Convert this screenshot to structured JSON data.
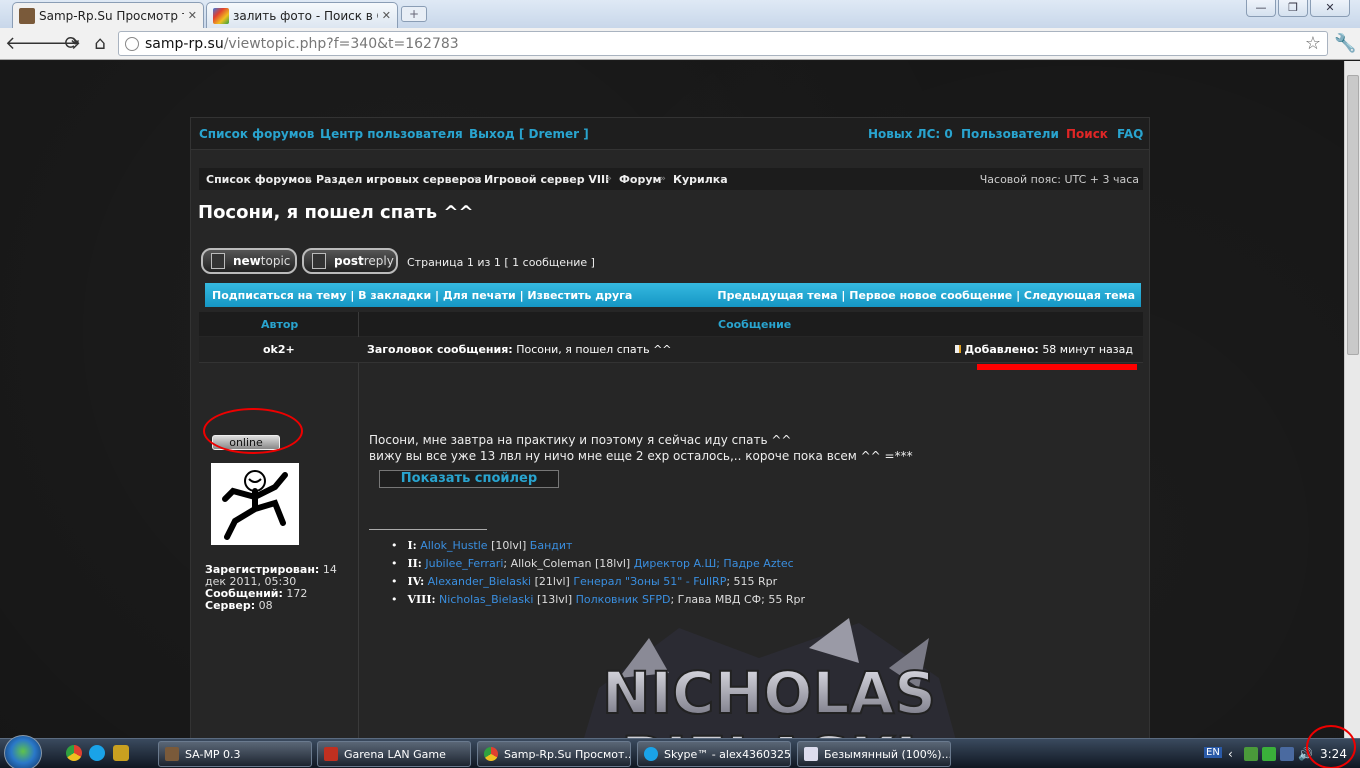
{
  "tabs": [
    {
      "title": "Samp-Rp.Su Просмотр темы -",
      "active": true
    },
    {
      "title": "залить фото - Поиск в Googl",
      "active": false
    }
  ],
  "window_controls": {
    "minimize": "—",
    "maximize": "❐",
    "close": "✕"
  },
  "url": {
    "host": "samp-rp.su",
    "path": "/viewtopic.php?f=340&t=162783"
  },
  "forum": {
    "nav_left": [
      "Список форумов",
      "Центр пользователя",
      "Выход [ Dremer ]"
    ],
    "nav_right": [
      "Новых ЛС: 0",
      "Пользователи",
      "Поиск",
      "FAQ"
    ],
    "breadcrumbs": [
      "Список форумов",
      "Раздел игровых серверов",
      "Игровой сервер VIII",
      "Форум",
      "Курилка"
    ],
    "timezone": "Часовой пояс: UTC + 3 часа",
    "topic_title": "Посони, я пошел спать ^^",
    "newtopic": {
      "bold": "new",
      "rest": "topic"
    },
    "postreply": {
      "bold": "post",
      "rest": "reply"
    },
    "pagination": "Страница 1 из 1   [ 1 сообщение ]",
    "actions_left": "Подписаться на тему | В закладки | Для печати | Известить друга",
    "actions_right": "Предыдущая тема | Первое новое сообщение | Следующая тема",
    "col_author": "Автор",
    "col_message": "Сообщение",
    "post": {
      "author": "ok2+",
      "subject_label": "Заголовок сообщения:",
      "subject": "Посони, я пошел спать ^^",
      "added_label": "Добавлено:",
      "added_time": "58 минут назад",
      "online": "online",
      "body_line1": "Посони, мне завтра на практику и поэтому я сейчас иду спать ^^",
      "body_line2": "вижу вы все уже 13 лвл ну ничо мне еще 2 exp осталось,.. короче пока всем ^^ =***",
      "spoiler": "Показать спойлер",
      "registered_label": "Зарегистрирован:",
      "registered": "14 дек 2011, 05:30",
      "posts_label": "Сообщений:",
      "posts": "172",
      "server_label": "Сервер:",
      "server": "08"
    },
    "signature": [
      {
        "num": "I:",
        "name": "Allok_Hustle",
        "mid": "[10lvl]",
        "extra": "Бандит",
        "tail": ""
      },
      {
        "num": "II:",
        "name": "Jubilee_Ferrari",
        "mid": "; Allok_Coleman [18lvl]",
        "extra": "Директор А.Ш; Падре Aztec",
        "tail": ""
      },
      {
        "num": "IV:",
        "name": "Alexander_Bielaski",
        "mid": "[21lvl]",
        "extra": "Генерал \"Зоны 51\" - FullRP",
        "tail": "; 515 Rpr"
      },
      {
        "num": "VIII:",
        "name": "Nicholas_Bielaski",
        "mid": "[13lvl]",
        "extra": "Полковник SFPD",
        "tail": "; Глава МВД СФ; 55 Rpr"
      }
    ],
    "signature_art_text": [
      "NICHOLAS",
      "BIELASKI"
    ]
  },
  "taskbar": {
    "items": [
      "SA-MP 0.3",
      "Garena LAN Game",
      "Samp-Rp.Su Просмот...",
      "Skype™ - alex4360325",
      "Безымянный (100%)..."
    ],
    "lang": "EN",
    "clock": "3:24"
  },
  "colors": {
    "link": "#29a4cf",
    "search_red": "#e02626",
    "cyan_bar": "#1fa9d6"
  }
}
